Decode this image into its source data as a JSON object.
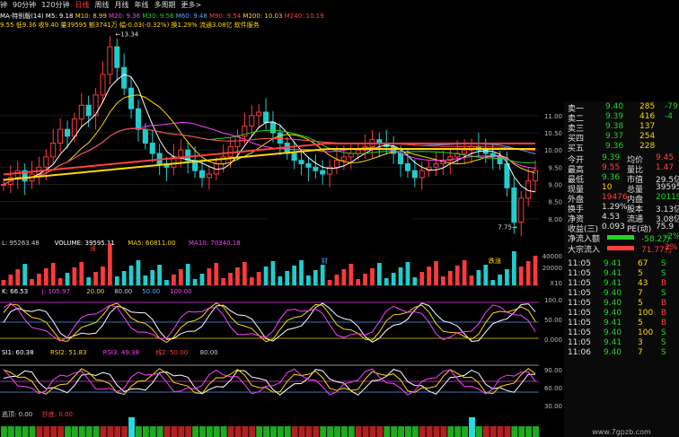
{
  "topbar": {
    "tabs": [
      "钟",
      "90分钟",
      "120分钟",
      "日线",
      "周线",
      "月线",
      "年线",
      "多周期",
      "更多>"
    ],
    "active_index": 3
  },
  "ma_header": {
    "name": "MA-特别版(14)",
    "items": [
      {
        "label": "M5: 9.18",
        "color": "#ffffff"
      },
      {
        "label": "M10: 8.99",
        "color": "#ffd800"
      },
      {
        "label": "M20: 9.36",
        "color": "#ff40ff"
      },
      {
        "label": "M30: 9.56",
        "color": "#22d422"
      },
      {
        "label": "M60: 9.48",
        "color": "#5fa0ff"
      },
      {
        "label": "M90: 9.54",
        "color": "#ff4040"
      },
      {
        "label": "M200: 10.03",
        "color": "#ffd800"
      },
      {
        "label": "M240: 10.19",
        "color": "#ff4040"
      }
    ]
  },
  "quote_line": "9.55 低9.36 收9.40 量39595 额3741万 幅-0.03(-0.32%) 换1.29% 流通3.08亿 软件服务",
  "main_labels": {
    "high_marker": "13.34",
    "low_marker": "7.75",
    "tag_zhang": "涨",
    "tag_cai": "财",
    "tag_diezhang": "跌涨"
  },
  "price_axis": [
    "11.00",
    "10.50",
    "10.00",
    "9.50",
    "9.00",
    "8.50",
    "8.00"
  ],
  "volume_header": [
    {
      "text": "L: 95263.48",
      "color": "#cccccc"
    },
    {
      "text": "VOLUME: 39595.11",
      "color": "#ffffff"
    },
    {
      "text": "MA5: 60811.00",
      "color": "#ffd800"
    },
    {
      "text": "MA10: 70340.18",
      "color": "#ff40ff"
    }
  ],
  "volume_axis": [
    "40000",
    "20000"
  ],
  "volume_unit": "X10",
  "kdj_header": [
    {
      "text": "K: 66.53",
      "color": "#ffffff"
    },
    {
      "text": "J: 105.97",
      "color": "#ff40ff"
    },
    {
      "text": "20.00",
      "color": "#ffd800"
    },
    {
      "text": "80.00",
      "color": "#cccccc"
    },
    {
      "text": "50.00",
      "color": "#5fa0ff"
    },
    {
      "text": "100.00",
      "color": "#ff40ff"
    }
  ],
  "kdj_axis": [
    "100.0",
    "50.00",
    "0.000"
  ],
  "rsi_header": [
    {
      "text": "SI1: 60.38",
      "color": "#ffffff"
    },
    {
      "text": "RSI2: 51.83",
      "color": "#ffd800"
    },
    {
      "text": "RSI3: 49.38",
      "color": "#ff40ff"
    },
    {
      "text": "线2: 50.00",
      "color": "#ff4040"
    },
    {
      "text": "80.00",
      "color": "#cccccc"
    }
  ],
  "rsi_axis": [
    "90.00",
    "60.00",
    "30.00"
  ],
  "bottom_header": [
    {
      "text": "逃顶: 0.00",
      "color": "#cccccc"
    },
    {
      "text": "抄底: 0.00",
      "color": "#ff4040"
    }
  ],
  "order_book": [
    {
      "label": "卖一",
      "price": "9.40",
      "vol": "285",
      "chg": "-79"
    },
    {
      "label": "卖二",
      "price": "9.39",
      "vol": "416",
      "chg": "-4"
    },
    {
      "label": "卖三",
      "price": "9.38",
      "vol": "137",
      "chg": ""
    },
    {
      "label": "买四",
      "price": "9.37",
      "vol": "254",
      "chg": ""
    },
    {
      "label": "买五",
      "price": "9.36",
      "vol": "228",
      "chg": ""
    }
  ],
  "stats": [
    {
      "l1": "今开",
      "v1": "9.39",
      "c1": "g",
      "l2": "均价",
      "v2": "9.45",
      "c2": "r"
    },
    {
      "l1": "最高",
      "v1": "9.55",
      "c1": "r",
      "l2": "量比",
      "v2": "1.47",
      "c2": "r"
    },
    {
      "l1": "最低",
      "v1": "9.36",
      "c1": "g",
      "l2": "市值",
      "v2": "29.5亿",
      "c2": "w"
    },
    {
      "l1": "现量",
      "v1": "10",
      "c1": "y",
      "l2": "总量",
      "v2": "39595",
      "c2": "w"
    },
    {
      "l1": "外盘",
      "v1": "19476",
      "c1": "r",
      "l2": "内盘",
      "v2": "20119",
      "c2": "g"
    },
    {
      "l1": "换手",
      "v1": "1.29%",
      "c1": "w",
      "l2": "股本",
      "v2": "3.13亿",
      "c2": "w"
    },
    {
      "l1": "净资",
      "v1": "4.53",
      "c1": "w",
      "l2": "流通",
      "v2": "3.08亿",
      "c2": "w"
    },
    {
      "l1": "收益(三)",
      "v1": "0.093",
      "c1": "w",
      "l2": "PE(动)",
      "v2": "75.9",
      "c2": "w"
    }
  ],
  "flows": [
    {
      "label": "净流入额",
      "value": "-58.2万",
      "pct": "-2%",
      "color": "#22d422"
    },
    {
      "label": "大宗流入",
      "value": "71.77万",
      "pct": "2%",
      "color": "#ff4040"
    }
  ],
  "ticks": [
    {
      "time": "11:05",
      "price": "9.41",
      "vol": "67",
      "side": "S"
    },
    {
      "time": "11:05",
      "price": "9.41",
      "vol": "5",
      "side": "S"
    },
    {
      "time": "11:05",
      "price": "9.41",
      "vol": "43",
      "side": "B"
    },
    {
      "time": "11:05",
      "price": "9.40",
      "vol": "7",
      "side": "S"
    },
    {
      "time": "11:05",
      "price": "9.40",
      "vol": "5",
      "side": "B"
    },
    {
      "time": "11:05",
      "price": "9.40",
      "vol": "100",
      "side": "B"
    },
    {
      "time": "11:05",
      "price": "9.41",
      "vol": "5",
      "side": "B"
    },
    {
      "time": "11:05",
      "price": "9.40",
      "vol": "100",
      "side": "S"
    },
    {
      "time": "11:05",
      "price": "9.41",
      "vol": "3",
      "side": "S"
    },
    {
      "time": "11:06",
      "price": "9.40",
      "vol": "7",
      "side": "S"
    }
  ],
  "watermark": "www.7gpzb.com",
  "chart_data": {
    "type": "candlestick",
    "title": "MA-特别版(14)",
    "ylim": [
      7.5,
      13.5
    ],
    "close_approx": [
      9.0,
      9.2,
      9.4,
      9.1,
      9.3,
      9.5,
      9.8,
      10.2,
      10.6,
      10.4,
      10.9,
      11.3,
      11.0,
      11.6,
      12.2,
      13.0,
      12.4,
      11.8,
      11.2,
      10.6,
      10.2,
      9.9,
      9.6,
      9.5,
      9.8,
      10.0,
      9.7,
      9.4,
      9.2,
      9.3,
      9.6,
      9.8,
      10.1,
      10.4,
      10.7,
      11.0,
      11.1,
      10.8,
      10.5,
      10.2,
      9.9,
      9.7,
      9.6,
      9.5,
      9.4,
      9.3,
      9.5,
      9.7,
      9.8,
      9.9,
      10.0,
      10.1,
      10.3,
      10.2,
      10.1,
      9.9,
      9.6,
      9.4,
      9.2,
      9.4,
      9.5,
      9.6,
      9.7,
      9.8,
      9.9,
      10.0,
      10.1,
      10.0,
      9.9,
      9.8,
      9.6,
      8.9,
      7.9,
      8.6,
      9.1,
      9.4
    ],
    "high": 13.34,
    "low": 7.75
  }
}
